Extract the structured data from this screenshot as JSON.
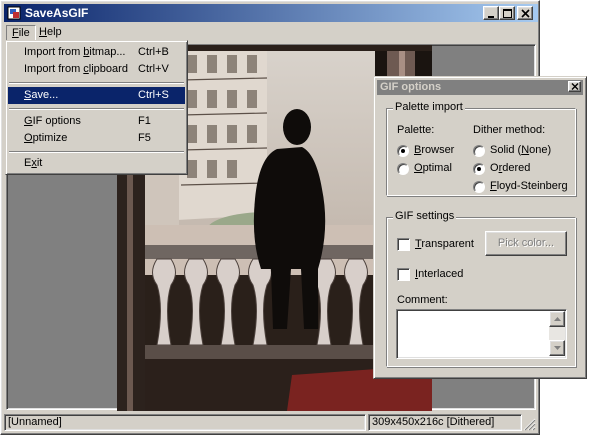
{
  "window": {
    "title": "SaveAsGIF"
  },
  "menubar": [
    {
      "label_prefix": "",
      "label_ul": "F",
      "label_rest": "ile"
    },
    {
      "label_prefix": "",
      "label_ul": "H",
      "label_rest": "elp"
    }
  ],
  "file_menu": {
    "items": [
      {
        "pre": "Import from ",
        "ul": "b",
        "post": "itmap...",
        "shortcut": "Ctrl+B"
      },
      {
        "pre": "Import from ",
        "ul": "c",
        "post": "lipboard",
        "shortcut": "Ctrl+V"
      },
      {
        "pre": "",
        "ul": "S",
        "post": "ave...",
        "shortcut": "Ctrl+S",
        "highlighted": true
      },
      {
        "pre": "",
        "ul": "G",
        "post": "IF options",
        "shortcut": "F1"
      },
      {
        "pre": "",
        "ul": "O",
        "post": "ptimize",
        "shortcut": "F5"
      },
      {
        "pre": "E",
        "ul": "x",
        "post": "it",
        "shortcut": ""
      }
    ]
  },
  "statusbar": {
    "left": "[Unnamed]",
    "right": "309x450x216c [Dithered]"
  },
  "gif_dialog": {
    "title": "GIF options",
    "palette_import": {
      "title": "Palette import",
      "palette_label": "Palette:",
      "palette_options": [
        {
          "pre": "",
          "ul": "B",
          "post": "rowser",
          "selected": true
        },
        {
          "pre": "",
          "ul": "O",
          "post": "ptimal",
          "selected": false
        }
      ],
      "dither_label": "Dither method:",
      "dither_options": [
        {
          "pre": "Solid (",
          "ul": "N",
          "post": "one)",
          "selected": false
        },
        {
          "pre": "O",
          "ul": "r",
          "post": "dered",
          "selected": true
        },
        {
          "pre": "",
          "ul": "F",
          "post": "loyd-Steinberg",
          "selected": false
        }
      ]
    },
    "gif_settings": {
      "title": "GIF settings",
      "transparent": {
        "pre": "",
        "ul": "T",
        "post": "ransparent",
        "checked": false
      },
      "interlaced": {
        "pre": "",
        "ul": "I",
        "post": "nterlaced",
        "checked": false
      },
      "pick_color_label": "Pick color...",
      "comment_label": "Comment:",
      "comment_value": ""
    }
  },
  "colors": {
    "active_title_start": "#0a246a",
    "active_title_end": "#a6caf0",
    "inactive_title": "#808080",
    "face": "#d4d0c8",
    "highlight": "#0a246a"
  }
}
